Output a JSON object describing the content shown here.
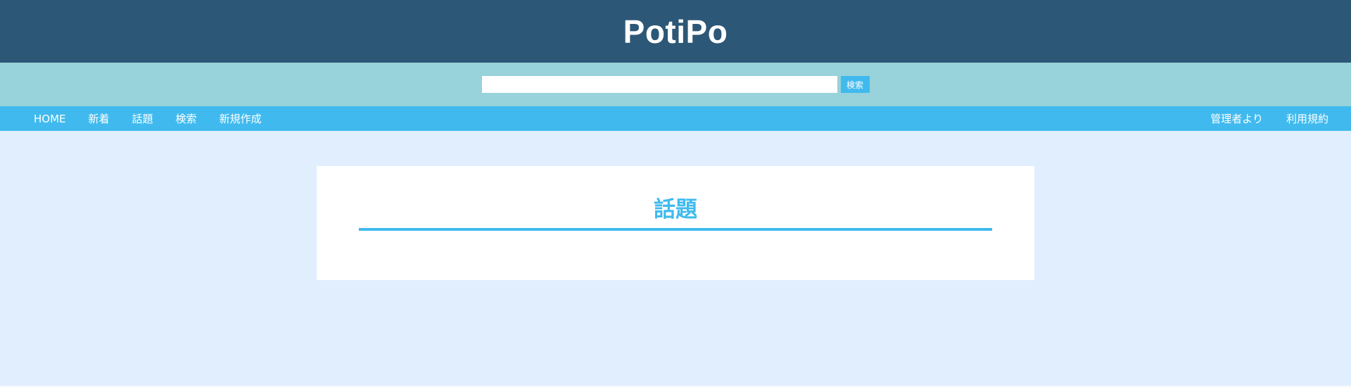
{
  "header": {
    "title": "PotiPo"
  },
  "search": {
    "value": "",
    "placeholder": "",
    "button_label": "検索"
  },
  "nav": {
    "left": [
      {
        "label": "HOME"
      },
      {
        "label": "新着"
      },
      {
        "label": "話題"
      },
      {
        "label": "検索"
      },
      {
        "label": "新規作成"
      }
    ],
    "right": [
      {
        "label": "管理者より"
      },
      {
        "label": "利用規約"
      }
    ]
  },
  "main": {
    "card_title": "話題"
  },
  "colors": {
    "header_bg": "#2d5776",
    "search_bar_bg": "#98d2da",
    "accent": "#40baee",
    "page_bg": "#e1eefd"
  }
}
